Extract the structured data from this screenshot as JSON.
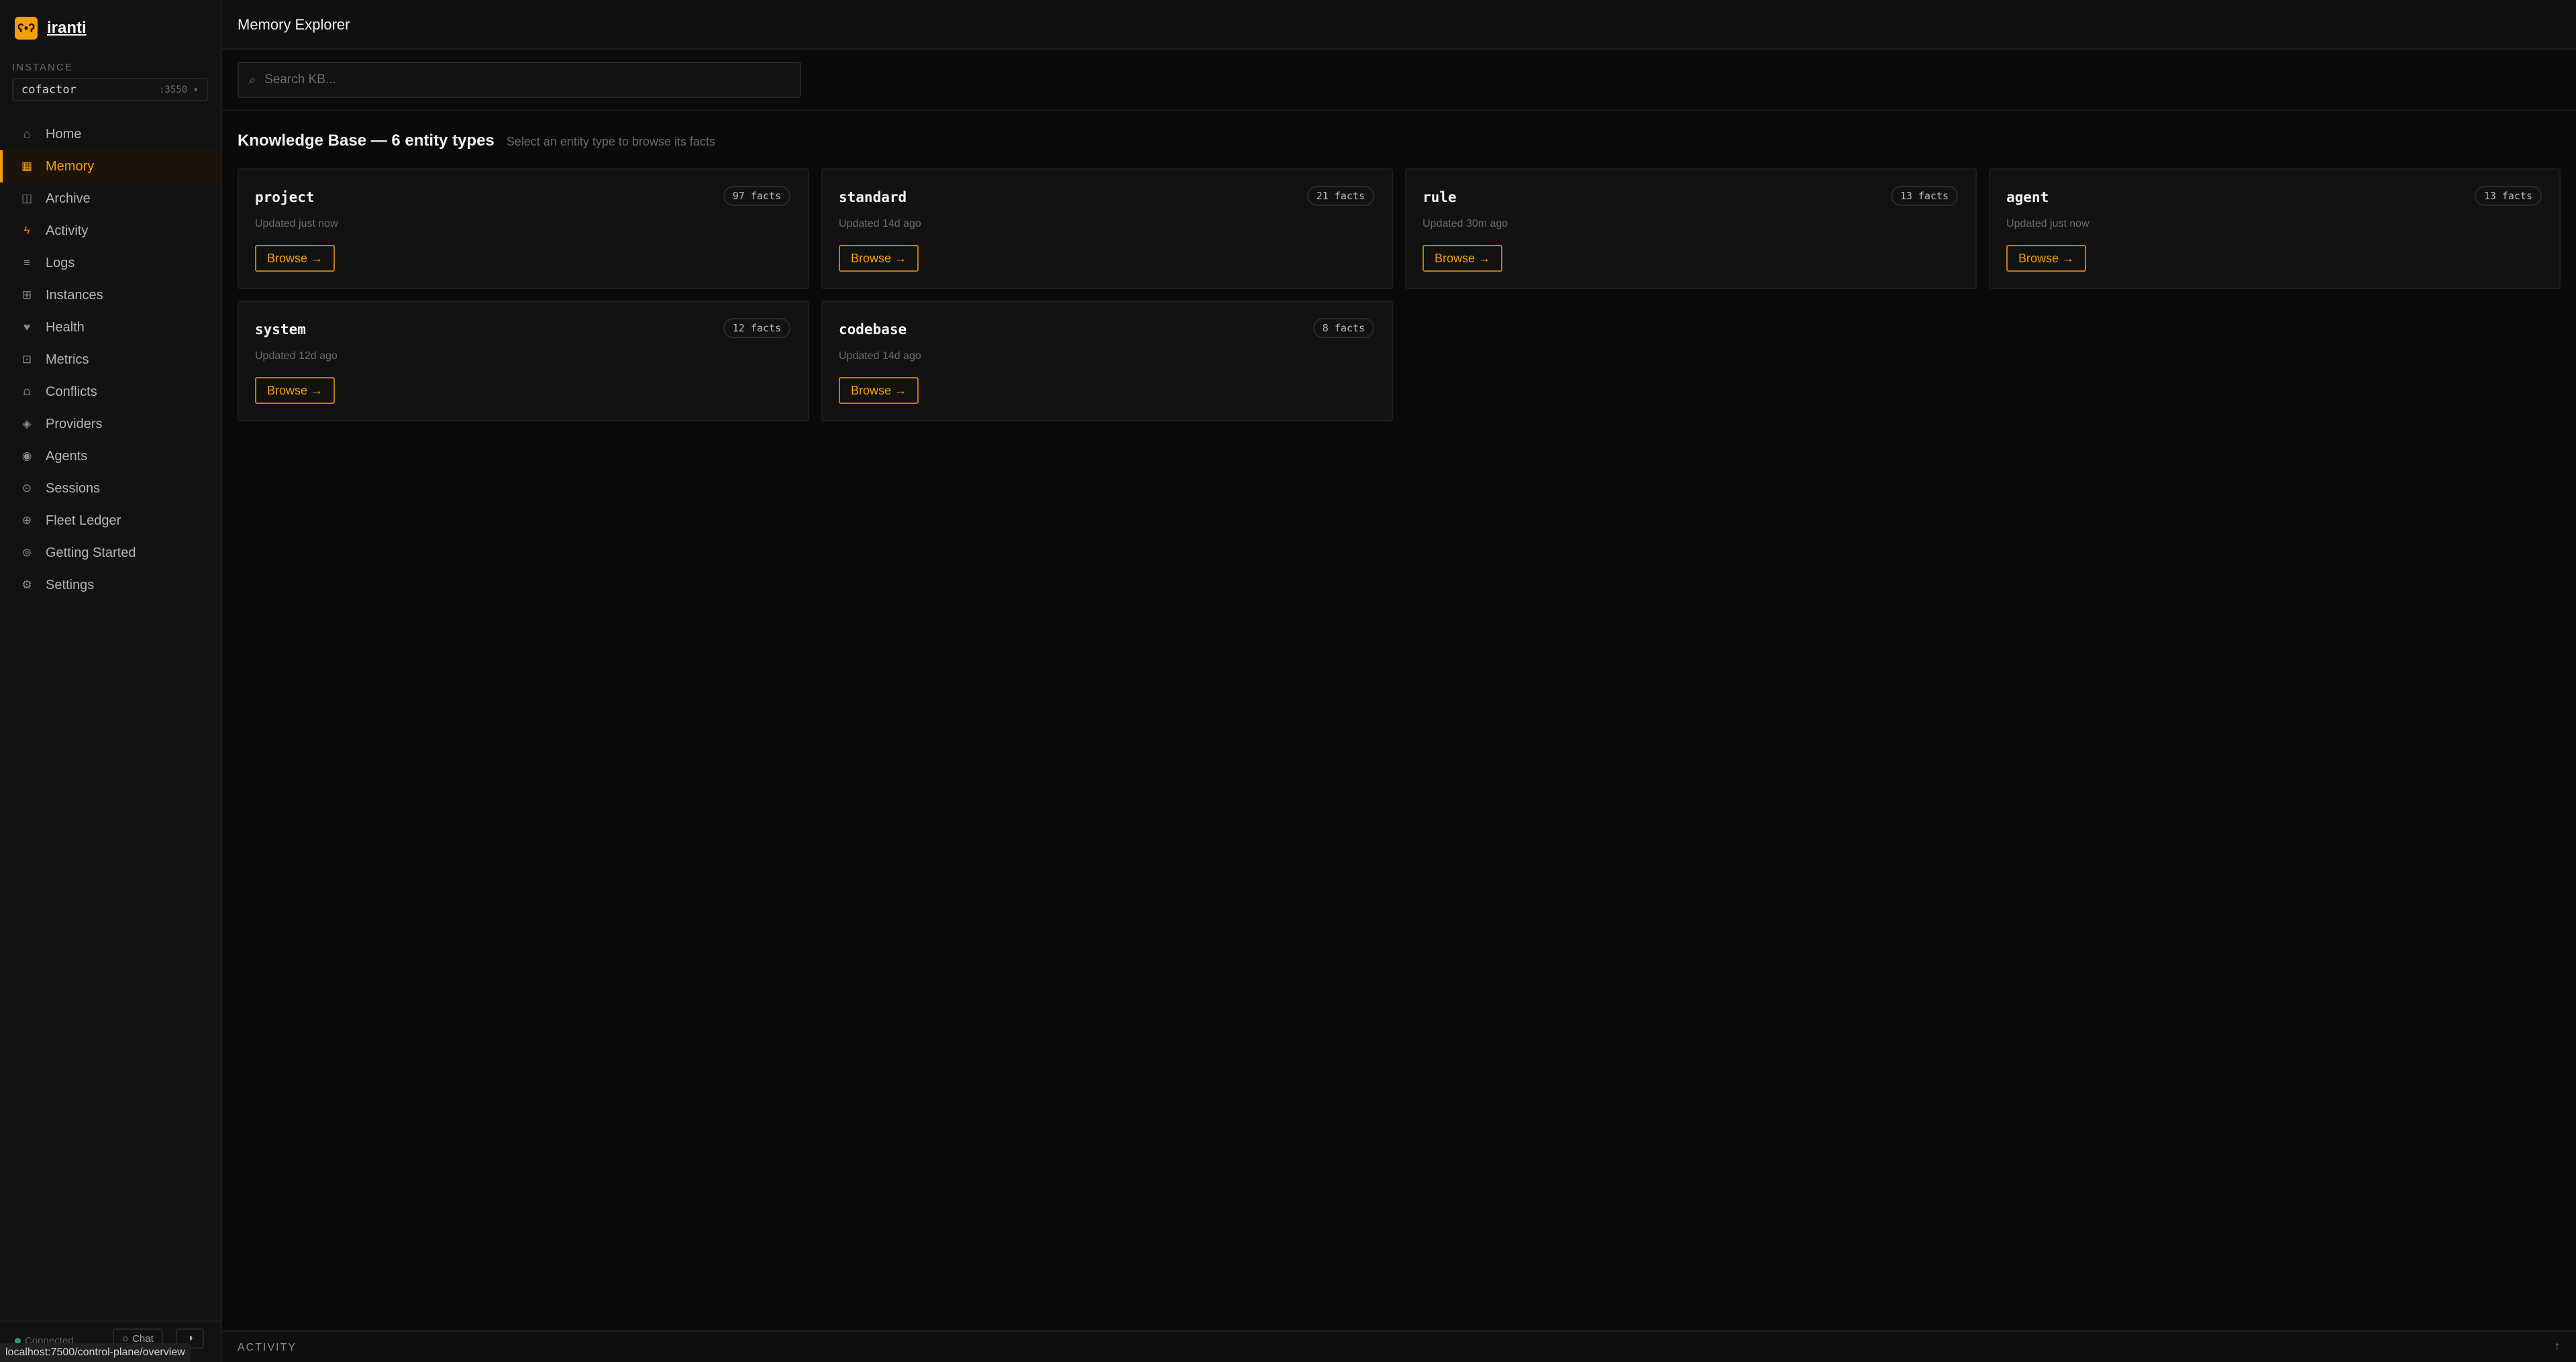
{
  "app": {
    "name": "iranti",
    "logo_glyph": "ʕ•ʔ",
    "accent_color": "#f59e0b"
  },
  "instance": {
    "label": "INSTANCE",
    "name": "cofactor",
    "port": ":3550 ▾"
  },
  "nav": [
    {
      "label": "Home",
      "icon": "house-icon",
      "glyph": "⌂",
      "active": false
    },
    {
      "label": "Memory",
      "icon": "database-icon",
      "glyph": "▦",
      "active": true
    },
    {
      "label": "Archive",
      "icon": "archive-icon",
      "glyph": "◫",
      "active": false
    },
    {
      "label": "Activity",
      "icon": "lightning-icon",
      "glyph": "ϟ",
      "active": false
    },
    {
      "label": "Logs",
      "icon": "list-icon",
      "glyph": "≡",
      "active": false
    },
    {
      "label": "Instances",
      "icon": "grid-icon",
      "glyph": "⊞",
      "active": false
    },
    {
      "label": "Health",
      "icon": "heart-icon",
      "glyph": "♥",
      "active": false
    },
    {
      "label": "Metrics",
      "icon": "metrics-icon",
      "glyph": "⊡",
      "active": false
    },
    {
      "label": "Conflicts",
      "icon": "conflicts-icon",
      "glyph": "⩍",
      "active": false
    },
    {
      "label": "Providers",
      "icon": "diamond-icon",
      "glyph": "◈",
      "active": false
    },
    {
      "label": "Agents",
      "icon": "agent-icon",
      "glyph": "◉",
      "active": false
    },
    {
      "label": "Sessions",
      "icon": "clock-icon",
      "glyph": "⊙",
      "active": false
    },
    {
      "label": "Fleet Ledger",
      "icon": "ledger-icon",
      "glyph": "⊕",
      "active": false
    },
    {
      "label": "Getting Started",
      "icon": "start-icon",
      "glyph": "⊚",
      "active": false
    },
    {
      "label": "Settings",
      "icon": "gear-icon",
      "glyph": "⚙",
      "active": false
    }
  ],
  "footer": {
    "connection": "Connected",
    "chat_label": "Chat",
    "theme_glyph": "◑",
    "status_url": "localhost:7500/control-plane/overview"
  },
  "header": {
    "title": "Memory Explorer"
  },
  "search": {
    "placeholder": "Search KB...",
    "icon_glyph": "⌕"
  },
  "kb": {
    "title": "Knowledge Base — 6 entity types",
    "subtitle": "Select an entity type to browse its facts"
  },
  "cards": [
    {
      "name": "project",
      "count": "97 facts",
      "updated": "Updated just now",
      "button": "Browse →"
    },
    {
      "name": "standard",
      "count": "21 facts",
      "updated": "Updated 14d ago",
      "button": "Browse →"
    },
    {
      "name": "rule",
      "count": "13 facts",
      "updated": "Updated 30m ago",
      "button": "Browse →"
    },
    {
      "name": "agent",
      "count": "13 facts",
      "updated": "Updated just now",
      "button": "Browse →"
    },
    {
      "name": "system",
      "count": "12 facts",
      "updated": "Updated 12d ago",
      "button": "Browse →"
    },
    {
      "name": "codebase",
      "count": "8 facts",
      "updated": "Updated 14d ago",
      "button": "Browse →"
    }
  ],
  "activity": {
    "label": "ACTIVITY",
    "toggle_glyph": "↑"
  }
}
